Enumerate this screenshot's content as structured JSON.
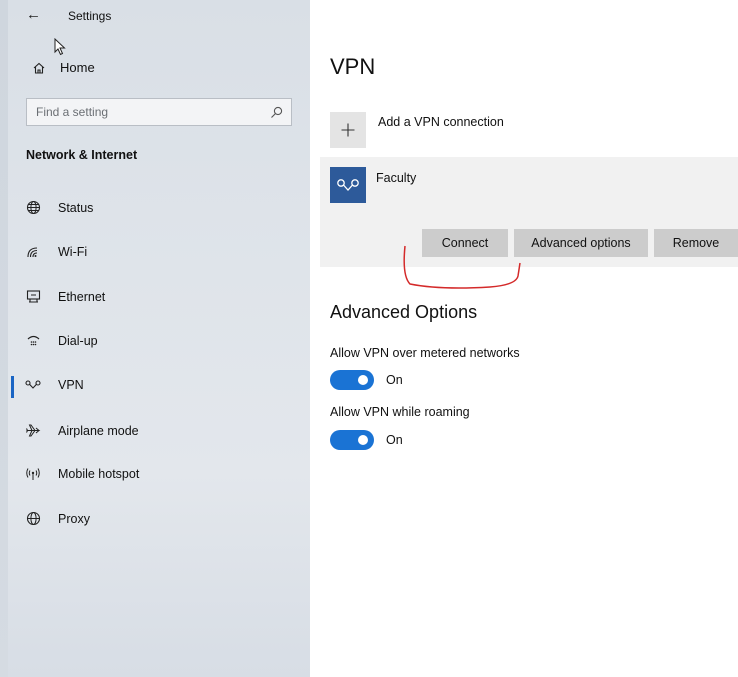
{
  "sidebar": {
    "app_title": "Settings",
    "home_label": "Home",
    "search_placeholder": "Find a setting",
    "section_title": "Network & Internet",
    "items": [
      {
        "label": "Status",
        "icon": "globe-status-icon"
      },
      {
        "label": "Wi-Fi",
        "icon": "wifi-icon"
      },
      {
        "label": "Ethernet",
        "icon": "ethernet-icon"
      },
      {
        "label": "Dial-up",
        "icon": "dialup-icon"
      },
      {
        "label": "VPN",
        "icon": "vpn-icon",
        "selected": true
      },
      {
        "label": "Airplane mode",
        "icon": "airplane-icon"
      },
      {
        "label": "Mobile hotspot",
        "icon": "hotspot-icon"
      },
      {
        "label": "Proxy",
        "icon": "globe-proxy-icon"
      }
    ]
  },
  "main": {
    "page_title": "VPN",
    "add_vpn_label": "Add a VPN connection",
    "connection": {
      "name": "Faculty",
      "connect_label": "Connect",
      "advanced_label": "Advanced options",
      "remove_label": "Remove"
    },
    "advanced_heading": "Advanced Options",
    "options": [
      {
        "label": "Allow VPN over metered networks",
        "state": "On",
        "on": true
      },
      {
        "label": "Allow VPN while roaming",
        "state": "On",
        "on": true
      }
    ]
  },
  "colors": {
    "accent": "#1a73d4",
    "vpn_tile": "#2d5a9a",
    "annotation": "#d42a2a"
  }
}
